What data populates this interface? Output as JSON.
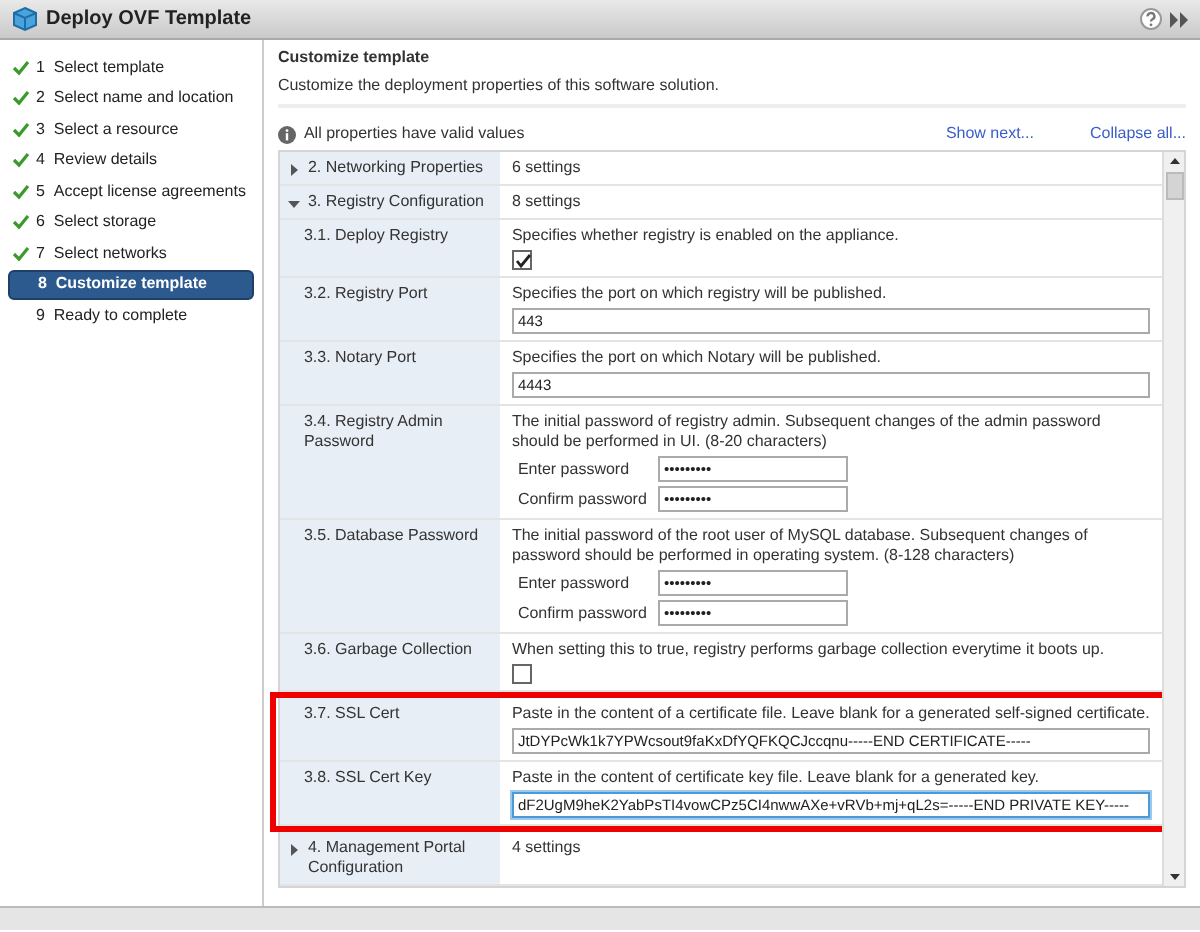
{
  "window": {
    "title": "Deploy OVF Template"
  },
  "steps": [
    {
      "number": "1",
      "label": "Select template",
      "done": true,
      "selected": false
    },
    {
      "number": "2",
      "label": "Select name and location",
      "done": true,
      "selected": false
    },
    {
      "number": "3",
      "label": "Select a resource",
      "done": true,
      "selected": false
    },
    {
      "number": "4",
      "label": "Review details",
      "done": true,
      "selected": false
    },
    {
      "number": "5",
      "label": "Accept license agreements",
      "done": true,
      "selected": false
    },
    {
      "number": "6",
      "label": "Select storage",
      "done": true,
      "selected": false
    },
    {
      "number": "7",
      "label": "Select networks",
      "done": true,
      "selected": false
    },
    {
      "number": "8",
      "label": "Customize template",
      "done": false,
      "selected": true
    },
    {
      "number": "9",
      "label": "Ready to complete",
      "done": false,
      "selected": false
    }
  ],
  "page": {
    "title": "Customize template",
    "description": "Customize the deployment properties of this software solution."
  },
  "status_message": "All properties have valid values",
  "links": [
    "Show next...",
    "Collapse all..."
  ],
  "properties": [
    {
      "kind": "group",
      "label": "2. Networking Properties",
      "summary": "6 settings",
      "expanded": false,
      "highlighted": false
    },
    {
      "kind": "group",
      "label": "3. Registry Configuration",
      "summary": "8 settings",
      "expanded": true,
      "highlighted": false
    },
    {
      "kind": "checkbox",
      "label": "3.1. Deploy Registry",
      "description": "Specifies whether registry is enabled on the appliance.",
      "checked": true,
      "highlighted": false
    },
    {
      "kind": "text",
      "label": "3.2. Registry Port",
      "description": "Specifies the port on which registry will be published.",
      "value": "443",
      "focused": false,
      "highlighted": false
    },
    {
      "kind": "text",
      "label": "3.3. Notary Port",
      "description": "Specifies the port on which Notary will be published.",
      "value": "4443",
      "focused": false,
      "highlighted": false
    },
    {
      "kind": "password",
      "label": "3.4. Registry Admin Password",
      "description": "The initial password of registry admin. Subsequent changes of the admin password should be performed in UI. (8-20 characters)",
      "fields": [
        {
          "label": "Enter password",
          "value": "•••••••••"
        },
        {
          "label": "Confirm password",
          "value": "•••••••••"
        }
      ],
      "highlighted": false
    },
    {
      "kind": "password",
      "label": "3.5. Database Password",
      "description": "The initial password of the root user of MySQL database. Subsequent changes of password should be performed in operating system. (8-128 characters)",
      "fields": [
        {
          "label": "Enter password",
          "value": "•••••••••"
        },
        {
          "label": "Confirm password",
          "value": "•••••••••"
        }
      ],
      "highlighted": false
    },
    {
      "kind": "checkbox",
      "label": "3.6. Garbage Collection",
      "description": "When setting this to true, registry performs garbage collection everytime it boots up.",
      "checked": false,
      "highlighted": false
    },
    {
      "kind": "text",
      "label": "3.7. SSL Cert",
      "description": "Paste in the content of a certificate file. Leave blank for a generated self-signed certificate.",
      "value": "JtDYPcWk1k7YPWcsout9faKxDfYQFKQCJccqnu-----END CERTIFICATE-----",
      "focused": false,
      "highlighted": true
    },
    {
      "kind": "text",
      "label": "3.8. SSL Cert Key",
      "description": "Paste in the content of certificate key file. Leave blank for a generated key.",
      "value": "dF2UgM9heK2YabPsTI4vowCPz5CI4nwwAXe+vRVb+mj+qL2s=-----END PRIVATE KEY-----",
      "focused": true,
      "highlighted": true
    },
    {
      "kind": "group",
      "label": "4. Management Portal Configuration",
      "summary": "4 settings",
      "expanded": false,
      "highlighted": false
    }
  ]
}
